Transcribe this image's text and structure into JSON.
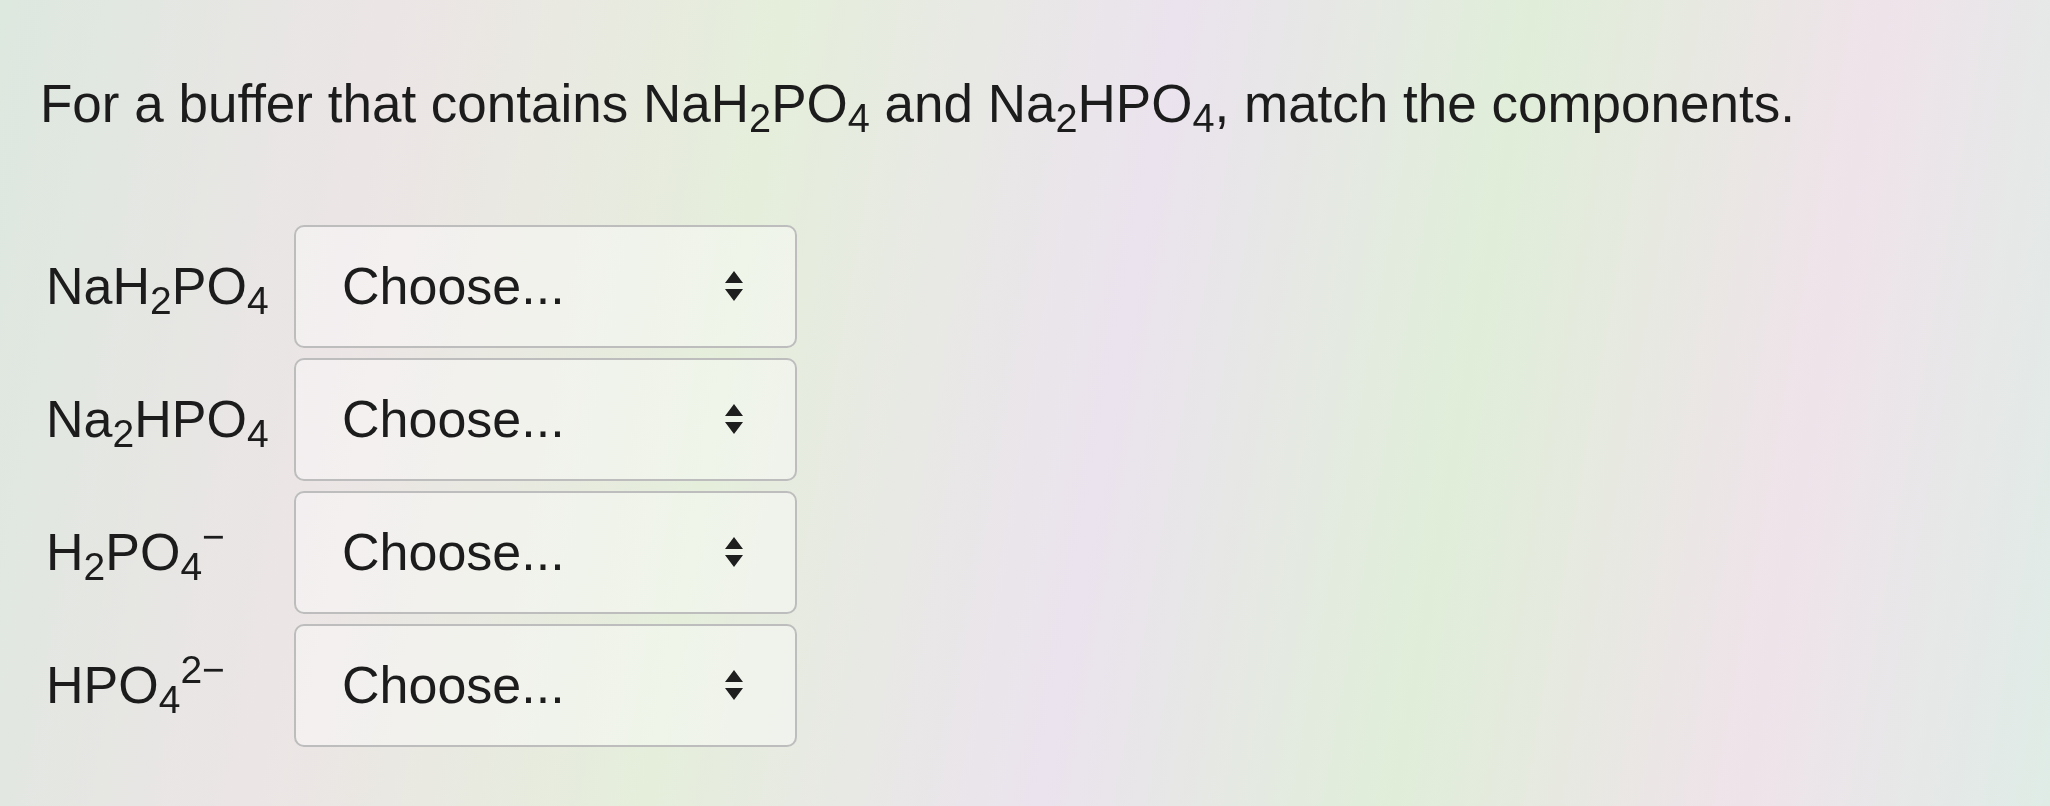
{
  "question": {
    "text": "For a buffer that contains NaH$_{2}$PO$_{4}$ and Na$_{2}$HPO$_{4}$, match the components."
  },
  "matches": [
    {
      "term": "NaH$_{2}$PO$_{4}$",
      "select": {
        "value": "Choose..."
      }
    },
    {
      "term": "Na$_{2}$HPO$_{4}$",
      "select": {
        "value": "Choose..."
      }
    },
    {
      "term": "H$_{2}$PO$_{4}$$^{−}$",
      "select": {
        "value": "Choose..."
      }
    },
    {
      "term": "HPO$_{4}$$^{2−}$",
      "select": {
        "value": "Choose..."
      }
    }
  ]
}
